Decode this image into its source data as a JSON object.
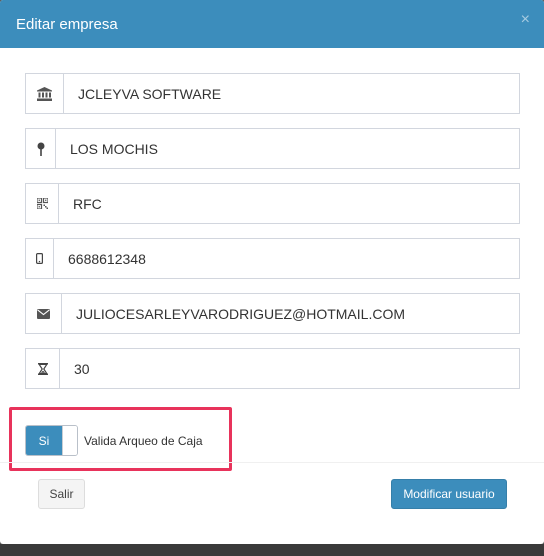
{
  "modal": {
    "title": "Editar empresa",
    "close_glyph": "×"
  },
  "fields": [
    {
      "icon": "bank-icon",
      "value": "JCLEYVA SOFTWARE"
    },
    {
      "icon": "map-pin-icon",
      "value": "LOS MOCHIS"
    },
    {
      "icon": "qrcode-icon",
      "value": "RFC"
    },
    {
      "icon": "mobile-phone-icon",
      "value": "6688612348"
    },
    {
      "icon": "envelope-icon",
      "value": "JULIOCESARLEYVARODRIGUEZ@HOTMAIL.COM"
    },
    {
      "icon": "hourglass-icon",
      "value": "30"
    }
  ],
  "toggle": {
    "on_label": "Si",
    "label": "Valida Arqueo de Caja",
    "state": "on"
  },
  "footer": {
    "exit_label": "Salir",
    "modify_label": "Modificar usuario"
  },
  "colors": {
    "header": "#3c8dbc",
    "primary_button": "#3c8dbc",
    "highlight": "#e8335b"
  }
}
